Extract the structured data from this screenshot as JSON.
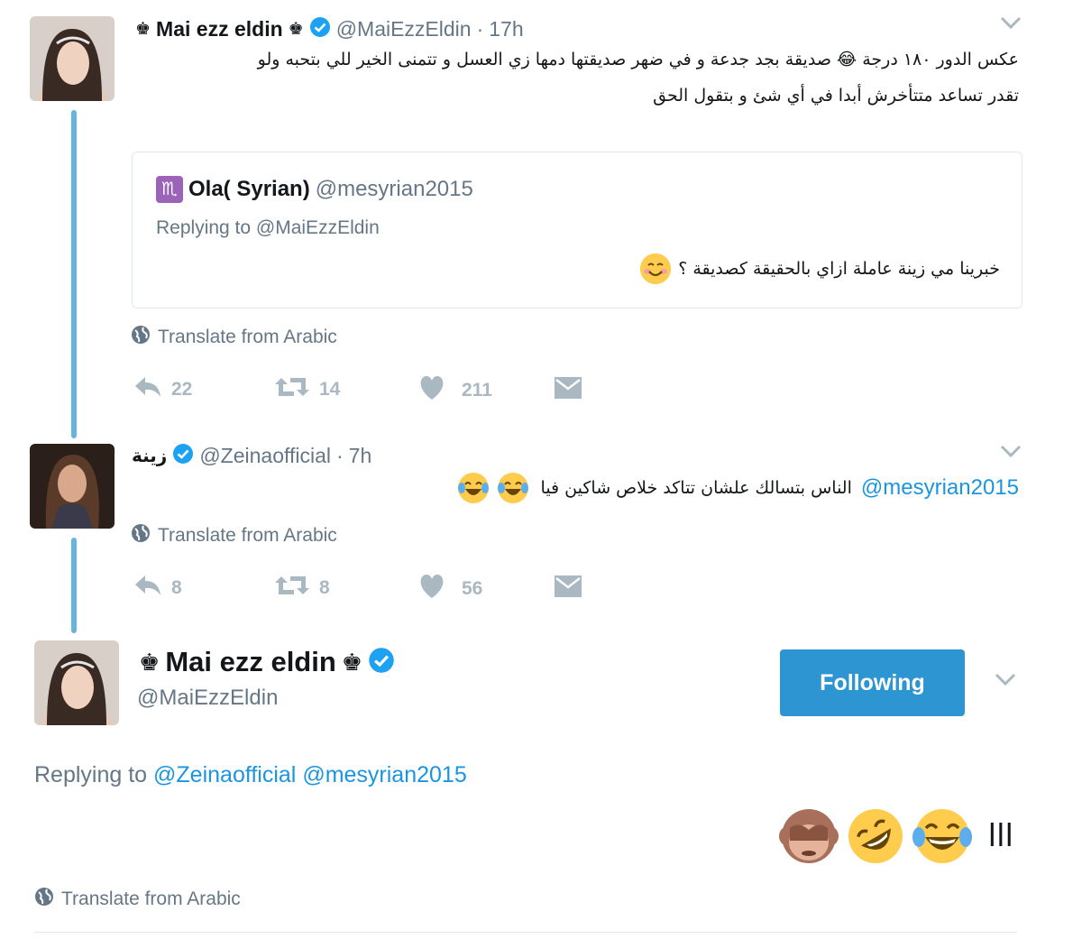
{
  "tweet1": {
    "name": "Mai ezz eldin",
    "handle": "@MaiEzzEldin",
    "time": "17h",
    "text_line1": "عكس الدور ١٨٠ درجة 😂 صديقة بجد جدعة و في ضهر صديقتها دمها زي العسل و تتمنى الخير للي بتحبه ولو",
    "text_line2": "تقدر تساعد متتأخرش أبدا في أي شئ و بتقول الحق",
    "quote": {
      "name": "Ola( Syrian)",
      "handle": "@mesyrian2015",
      "replying_prefix": "Replying to ",
      "replying_to": "@MaiEzzEldin",
      "text": "خبرينا مي زينة عاملة ازاي بالحقيقة كصديقة ؟"
    },
    "translate": "Translate from Arabic",
    "replies": "22",
    "retweets": "14",
    "likes": "211"
  },
  "tweet2": {
    "name": "زينة",
    "handle": "@Zeinaofficial",
    "time": "7h",
    "mention": "@mesyrian2015",
    "text": "الناس بتسالك علشان تتاكد خلاص شاكين فيا",
    "translate": "Translate from Arabic",
    "replies": "8",
    "retweets": "8",
    "likes": "56"
  },
  "main_tweet": {
    "name": "Mai ezz eldin",
    "handle": "@MaiEzzEldin",
    "follow_label": "Following",
    "replying_prefix": "Replying to ",
    "replying_to_1": "@Zeinaofficial",
    "replying_to_2": "@mesyrian2015",
    "text": "ااا",
    "translate": "Translate from Arabic"
  },
  "colors": {
    "accent": "#1b95e0",
    "follow_button": "#2d96d2",
    "thread_line": "#67b4dc",
    "verified": "#1da1f2",
    "muted": "#657786",
    "icon_gray": "#aab8c2"
  },
  "icons": [
    "crown-icon",
    "verified-badge-icon",
    "chevron-down-icon",
    "globe-icon",
    "reply-icon",
    "retweet-icon",
    "heart-icon",
    "direct-message-icon",
    "scorpio-icon",
    "tears-of-joy-emoji",
    "smiling-emoji",
    "rolling-laughing-emoji",
    "see-no-evil-monkey-emoji"
  ]
}
